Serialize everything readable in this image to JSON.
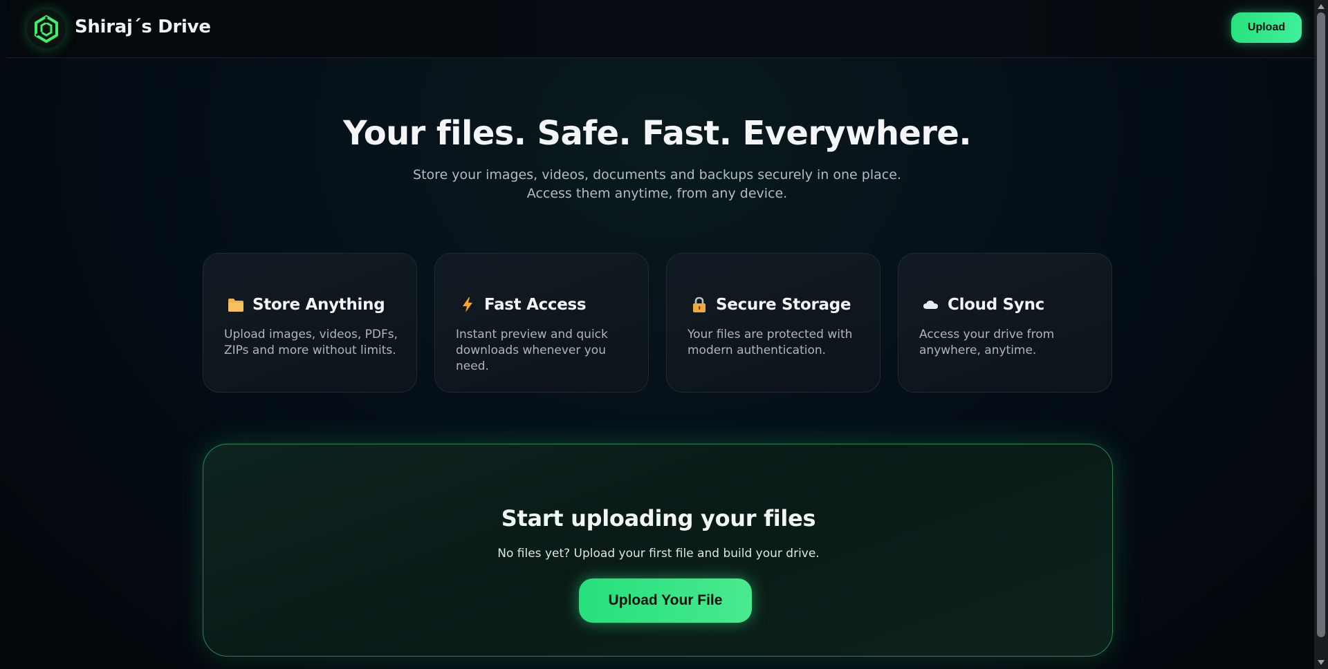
{
  "header": {
    "brand": "Shiraj´s Drive",
    "logo_icon": "shiraj-drive-logo-icon",
    "upload_label": "Upload"
  },
  "hero": {
    "title": "Your files. Safe. Fast. Everywhere.",
    "subtitle_line1": "Store your images, videos, documents and backups securely in one place.",
    "subtitle_line2": "Access them anytime, from any device."
  },
  "features": [
    {
      "icon": "folder-icon",
      "title": "Store Anything",
      "desc_line1": "Upload images, videos, PDFs,",
      "desc_line2": "ZIPs and more without limits."
    },
    {
      "icon": "lightning-icon",
      "title": "Fast Access",
      "desc_line1": "Instant preview and quick",
      "desc_line2": "downloads whenever you need."
    },
    {
      "icon": "lock-icon",
      "title": "Secure Storage",
      "desc_line1": "Your files are protected with",
      "desc_line2": "modern authentication."
    },
    {
      "icon": "cloud-icon",
      "title": "Cloud Sync",
      "desc_line1": "Access your drive from",
      "desc_line2": "anywhere, anytime."
    }
  ],
  "cta": {
    "title": "Start uploading your files",
    "subtitle": "No files yet? Upload your first file and build your drive.",
    "button_label": "Upload Your File"
  },
  "colors": {
    "accent": "#2ee582",
    "background": "#05101a",
    "card": "#101920",
    "text_primary": "#f2f4f6",
    "text_muted": "#aeb6bd"
  }
}
